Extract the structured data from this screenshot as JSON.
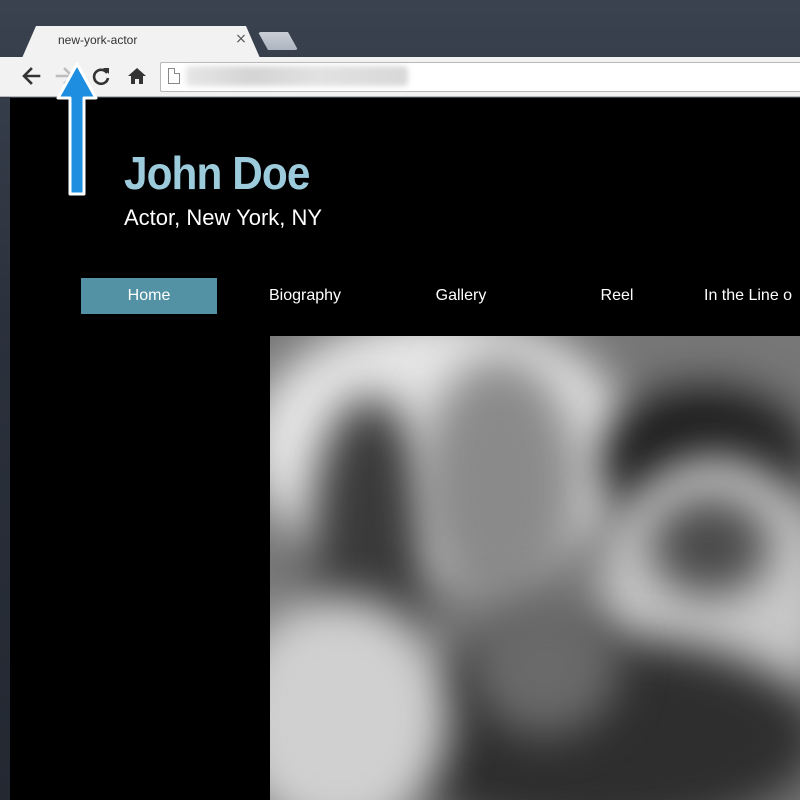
{
  "browser": {
    "tab_title": "new-york-actor",
    "tab_close_glyph": "×",
    "toolbar_icons": [
      "back-arrow-icon",
      "forward-arrow-icon",
      "reload-icon",
      "home-icon",
      "page-icon"
    ]
  },
  "site": {
    "name": "John Doe",
    "tagline": "Actor, New York, NY",
    "nav": [
      {
        "label": "Home",
        "active": true
      },
      {
        "label": "Biography",
        "active": false
      },
      {
        "label": "Gallery",
        "active": false
      },
      {
        "label": "Reel",
        "active": false
      },
      {
        "label": "In the Line o",
        "active": false
      }
    ]
  },
  "colors": {
    "name_accent": "#9ccbdc",
    "nav_active_bg": "#5392a4",
    "page_bg": "#000000",
    "annotation_arrow": "#1e8fe0"
  }
}
